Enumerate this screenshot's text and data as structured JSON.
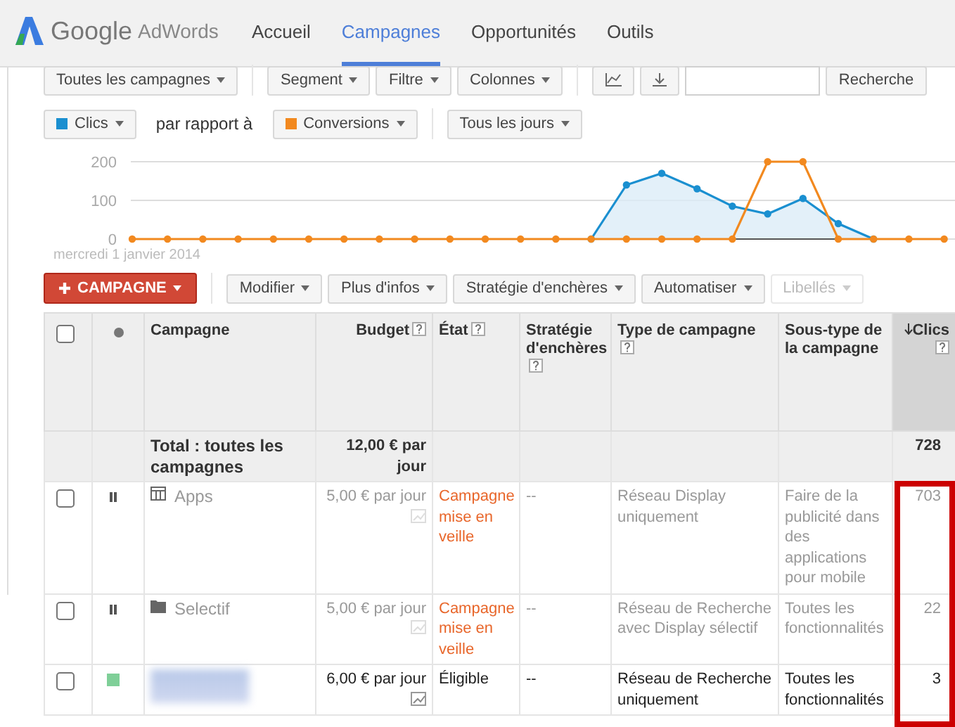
{
  "header": {
    "logo": {
      "brand": "Google",
      "product": "AdWords"
    },
    "nav": [
      {
        "label": "Accueil",
        "selected": false
      },
      {
        "label": "Campagnes",
        "selected": true
      },
      {
        "label": "Opportunités",
        "selected": false
      },
      {
        "label": "Outils",
        "selected": false
      }
    ]
  },
  "toolbar": {
    "items": [
      {
        "kind": "dropdown",
        "label": "Toutes les campagnes"
      },
      {
        "kind": "divider"
      },
      {
        "kind": "dropdown",
        "label": "Segment"
      },
      {
        "kind": "dropdown",
        "label": "Filtre"
      },
      {
        "kind": "dropdown",
        "label": "Colonnes"
      },
      {
        "kind": "divider"
      },
      {
        "kind": "chart"
      },
      {
        "kind": "download"
      },
      {
        "kind": "search"
      },
      {
        "kind": "button",
        "label": "Recherche"
      }
    ]
  },
  "metrics": {
    "compare_text": "par rapport à",
    "period": "Tous les jours"
  },
  "chart": {
    "start_date": "mercredi 1 janvier 2014",
    "chart_data": {
      "type": "line",
      "ylim": [
        0,
        200
      ],
      "yticks": [
        {
          "value": 0,
          "label": "0"
        },
        {
          "value": 100,
          "label": "100"
        },
        {
          "value": 200,
          "label": "200"
        }
      ],
      "series": [
        {
          "name": "Clics",
          "color": "#1a8fd0",
          "marker": true,
          "values": [
            null,
            null,
            null,
            null,
            null,
            null,
            null,
            null,
            null,
            null,
            null,
            null,
            null,
            0,
            140,
            170,
            130,
            85,
            65,
            105,
            40,
            0,
            null,
            null
          ]
        },
        {
          "name": "Conversions",
          "color": "#f2891f",
          "marker": true,
          "values": [
            0,
            0,
            0,
            0,
            0,
            0,
            0,
            0,
            0,
            0,
            0,
            0,
            0,
            0,
            0,
            0,
            0,
            0,
            200,
            200,
            0,
            0,
            0,
            0
          ]
        }
      ]
    }
  },
  "actions": [
    {
      "kind": "primary",
      "label": "CAMPAGNE",
      "disabled": false
    },
    {
      "kind": "dropdown",
      "label": "Modifier",
      "disabled": false
    },
    {
      "kind": "dropdown",
      "label": "Plus d'infos",
      "disabled": false
    },
    {
      "kind": "dropdown",
      "label": "Stratégie d'enchères",
      "disabled": false
    },
    {
      "kind": "dropdown",
      "label": "Automatiser",
      "disabled": false
    },
    {
      "kind": "dropdown",
      "label": "Libellés",
      "disabled": true
    }
  ],
  "table": {
    "columns": [
      {
        "kind": "checkbox",
        "checked": false
      },
      {
        "kind": "status"
      },
      {
        "kind": "text",
        "label": "Campagne",
        "help": false,
        "sorted": false
      },
      {
        "kind": "number",
        "label": "Budget",
        "help": true,
        "sorted": false
      },
      {
        "kind": "text",
        "label": "État",
        "help": true,
        "sorted": false
      },
      {
        "kind": "text",
        "label": "Stratégie d'enchères",
        "help": true,
        "sorted": false
      },
      {
        "kind": "text",
        "label": "Type de campagne",
        "help": true,
        "sorted": false
      },
      {
        "kind": "text",
        "label": "Sous-type de la campagne",
        "help": false,
        "sorted": false
      },
      {
        "kind": "number",
        "label": "Clics",
        "help": true,
        "sorted": true
      }
    ],
    "total": {
      "label": "Total : toutes les campagnes",
      "budget": "12,00 € par jour",
      "clicks": "728"
    },
    "rows": [
      {
        "kind": "apps",
        "checked": false,
        "paused": true,
        "name": "Apps",
        "budget": "5,00 € par jour",
        "state": "Campagne mise en veille",
        "strategy": "--",
        "type": "Réseau Display uniquement",
        "subtype": "Faire de la publicité dans des applications pour mobile",
        "clicks": "703"
      },
      {
        "kind": "folder",
        "checked": false,
        "paused": true,
        "name": "Selectif",
        "budget": "5,00 € par jour",
        "state": "Campagne mise en veille",
        "strategy": "--",
        "type": "Réseau de Recherche avec Display sélectif",
        "subtype": "Toutes les fonctionnalités",
        "clicks": "22"
      },
      {
        "kind": "blurred",
        "checked": false,
        "paused": false,
        "budget": "6,00 € par jour",
        "state": "Éligible",
        "strategy": "--",
        "type": "Réseau de Recherche uniquement",
        "subtype": "Toutes les fonctionnalités",
        "clicks": "3"
      }
    ],
    "highlight_column": true
  }
}
